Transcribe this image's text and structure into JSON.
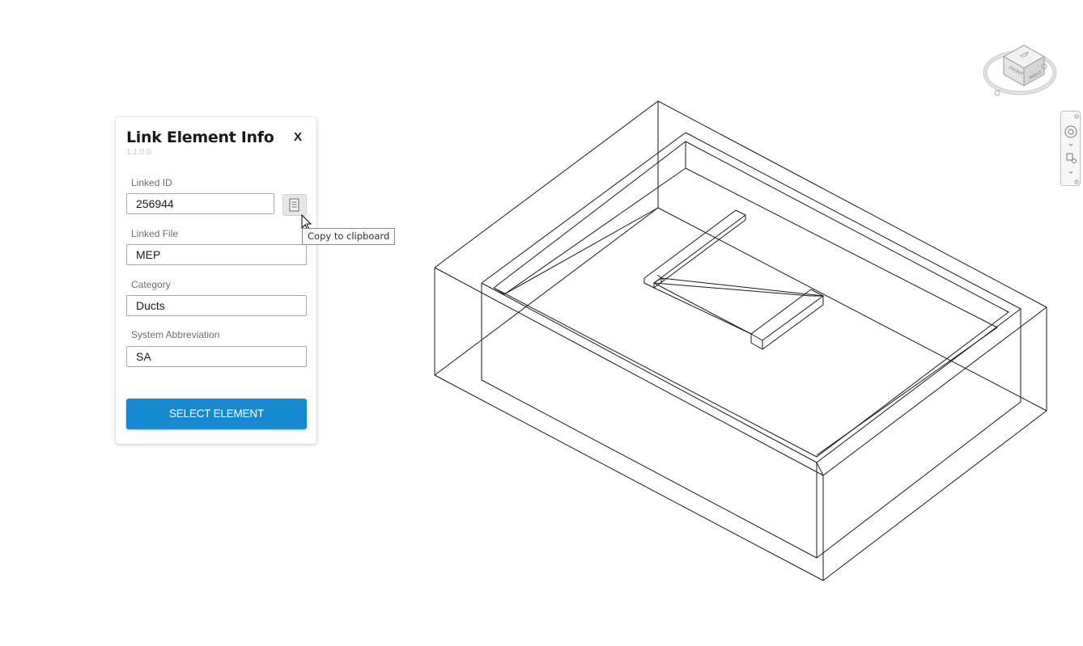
{
  "dialog": {
    "title": "Link Element Info",
    "version": "1.1.0.0",
    "close_label": "X",
    "fields": [
      {
        "label": "Linked ID",
        "value": "256944"
      },
      {
        "label": "Linked File",
        "value": "MEP"
      },
      {
        "label": "Category",
        "value": "Ducts"
      },
      {
        "label": "System Abbreviation",
        "value": "SA"
      }
    ],
    "copy_icon": "clipboard-icon",
    "select_button_label": "SELECT ELEMENT",
    "accent_color": "#1789d1"
  },
  "tooltip": {
    "text": "Copy to clipboard"
  },
  "view_cube": {
    "top_label": "TOP",
    "front_label": "FRONT",
    "right_label": "RIGHT"
  },
  "nav_bar": {
    "icons": [
      "steering-wheel-icon",
      "zoom-icon"
    ]
  }
}
